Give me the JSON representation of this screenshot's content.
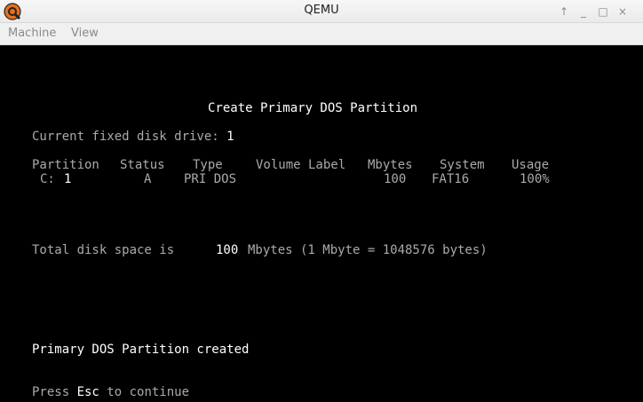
{
  "window": {
    "title": "QEMU",
    "controls": {
      "shade": "↑",
      "minimize": "_",
      "maximize": "□",
      "close": "×"
    },
    "icon": "qemu-logo-icon"
  },
  "menubar": {
    "items": [
      "Machine",
      "View"
    ]
  },
  "console": {
    "heading": "Create Primary DOS Partition",
    "drive_label": "Current fixed disk drive: ",
    "drive_value": "1",
    "columns": {
      "partition": "Partition",
      "status": "Status",
      "type": "Type",
      "volume_label": "Volume Label",
      "mbytes": "Mbytes",
      "system": "System",
      "usage": "Usage"
    },
    "row": {
      "drive": "C:",
      "partition": "1",
      "status": "A",
      "type": "PRI DOS",
      "volume_label": "",
      "mbytes": "100",
      "system": "FAT16",
      "usage": "100%"
    },
    "total_label": "Total disk space is",
    "total_value": "100",
    "total_suffix": "Mbytes (1 Mbyte = 1048576 bytes)",
    "message": "Primary DOS Partition created",
    "prompt_prefix": "Press ",
    "prompt_key": "Esc",
    "prompt_suffix": " to continue"
  },
  "colors": {
    "screen_bg": "#000000",
    "text_normal": "#aaaaaa",
    "text_bright": "#ffffff"
  }
}
